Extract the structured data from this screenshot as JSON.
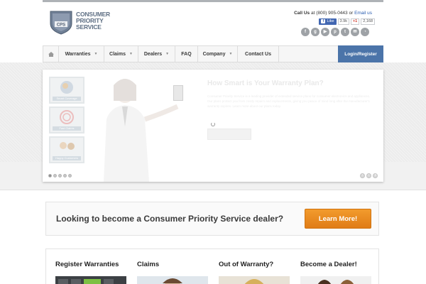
{
  "header": {
    "logo_line1": "Consumer",
    "logo_line2": "Priority",
    "logo_line3": "Service",
    "logo_badge": "CPS",
    "call_label": "Call Us",
    "call_at": "at",
    "phone": "(800) 905-0443",
    "or_text": "or",
    "email_label": "Email us",
    "fb_like": "Like",
    "fb_count": "3.9k",
    "gplus_label": "+1",
    "gplus_count": "2,168",
    "social_icons": [
      "facebook-icon",
      "google-plus-icon",
      "youtube-icon",
      "pinterest-icon",
      "twitter-icon",
      "email-icon",
      "rss-icon"
    ]
  },
  "nav": {
    "items": [
      {
        "label": "Warranties",
        "has_dropdown": true
      },
      {
        "label": "Claims",
        "has_dropdown": true
      },
      {
        "label": "Dealers",
        "has_dropdown": true
      },
      {
        "label": "FAQ",
        "has_dropdown": false
      },
      {
        "label": "Company",
        "has_dropdown": true
      },
      {
        "label": "Contact Us",
        "has_dropdown": false
      }
    ],
    "login_label": "Login/Register"
  },
  "slider": {
    "title": "How Smart is Your Warranty Plan?",
    "body": "Consumer Priority Service is a leading provider of extended service plans for consumer electronics and appliances. Our plans protect you from costly repairs and replacements, giving you peace of mind long after the manufacturer's warranty expires. Learn more about our plans today.",
    "thumb_captions": [
      "Smart Coverage",
      "Fast Claims",
      "Happy Customers"
    ],
    "dots": 5,
    "active_dot": 0
  },
  "cta": {
    "text": "Looking to become a Consumer Priority Service dealer?",
    "button": "Learn More!"
  },
  "columns": [
    {
      "title": "Register Warranties"
    },
    {
      "title": "Claims"
    },
    {
      "title": "Out of Warranty?"
    },
    {
      "title": "Become a Dealer!"
    }
  ],
  "colors": {
    "accent_blue": "#4b74a9",
    "cta_orange": "#e98a20",
    "logo_gray": "#5e6f84"
  }
}
